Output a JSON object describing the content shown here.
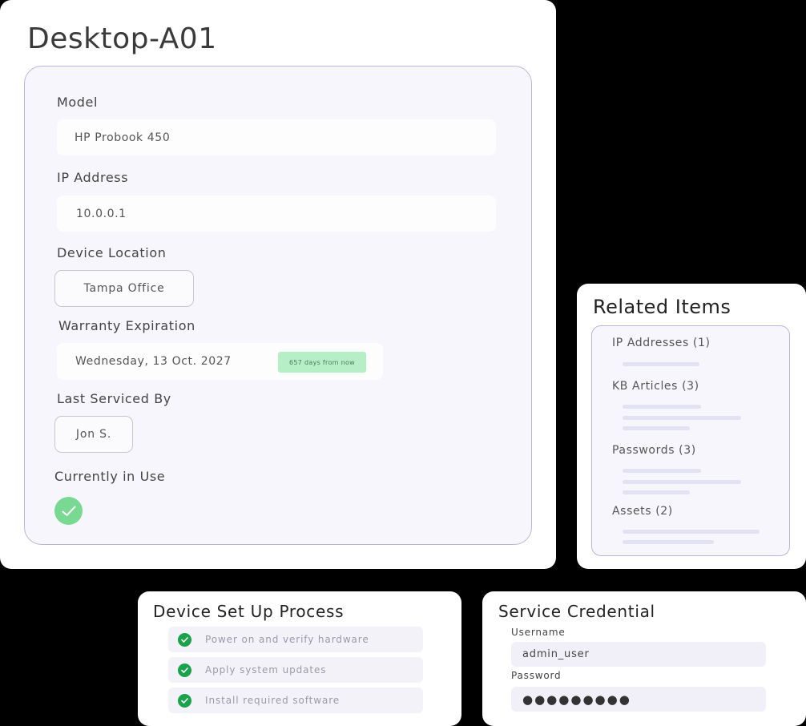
{
  "device": {
    "title": "Desktop-A01",
    "model_label": "Model",
    "model_value": "HP Probook 450",
    "ip_label": "IP Address",
    "ip_value": "10.0.0.1",
    "location_label": "Device Location",
    "location_value": "Tampa Office",
    "warranty_label": "Warranty Expiration",
    "warranty_value": "Wednesday, 13 Oct. 2027",
    "warranty_badge": "657 days from now",
    "serviced_label": "Last Serviced By",
    "serviced_value": "Jon S.",
    "in_use_label": "Currently in Use",
    "in_use": true
  },
  "related": {
    "title": "Related Items",
    "items": [
      {
        "label": "IP Addresses (1)"
      },
      {
        "label": "KB Articles (3)"
      },
      {
        "label": "Passwords (3)"
      },
      {
        "label": "Assets (2)"
      }
    ]
  },
  "setup": {
    "title": "Device Set Up Process",
    "steps": [
      {
        "label": "Power on and verify hardware",
        "done": true
      },
      {
        "label": "Apply system updates",
        "done": true
      },
      {
        "label": "Install required software",
        "done": true
      }
    ]
  },
  "credential": {
    "title": "Service Credential",
    "username_label": "Username",
    "username_value": "admin_user",
    "password_label": "Password",
    "password_value": "●●●●●●●●●"
  },
  "colors": {
    "accent_check": "#79d993",
    "step_check": "#1aa34a",
    "badge_bg": "#b6efc6",
    "panel_border": "#b9b6dc"
  },
  "icons": {
    "in_use": "check-icon",
    "step": "check-circle-icon"
  }
}
